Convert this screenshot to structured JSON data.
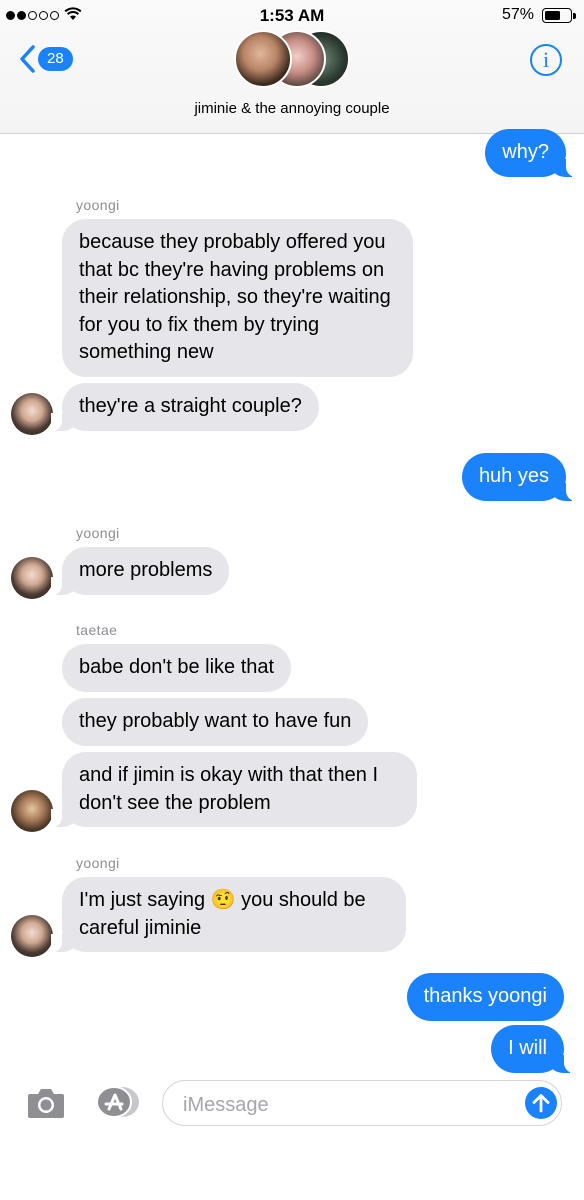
{
  "status_bar": {
    "time": "1:53 AM",
    "battery_percent": "57%",
    "battery_level": 0.57,
    "signal_bars_filled": 2,
    "signal_bars_total": 5
  },
  "header": {
    "back_count": "28",
    "title": "jiminie & the annoying couple",
    "info_glyph": "i"
  },
  "messages": [
    {
      "text": "why?"
    },
    {
      "sender": "yoongi",
      "text": "because they probably offered you that bc they're having problems on their relationship, so they're waiting for you to fix them by trying something new"
    },
    {
      "text": "they're a straight couple?"
    },
    {
      "text": "huh yes"
    },
    {
      "sender": "yoongi",
      "text": "more problems"
    },
    {
      "sender": "taetae",
      "text": "babe don't be like that"
    },
    {
      "text": "they probably want to have fun"
    },
    {
      "text": "and if jimin is okay with that then I don't see the problem"
    },
    {
      "sender": "yoongi",
      "text_before": "I'm just saying",
      "emoji": "🤨",
      "text_after": "you should be careful jiminie"
    },
    {
      "text": "thanks yoongi"
    },
    {
      "text": "I will"
    }
  ],
  "input": {
    "placeholder": "iMessage"
  },
  "icons": {
    "camera": "camera-icon",
    "apps": "app-store-icon",
    "send": "send-arrow-icon",
    "back": "chevron-left-icon",
    "wifi": "wifi-icon",
    "info": "info-icon"
  },
  "colors": {
    "accent": "#1a82fb",
    "incoming_bubble": "#e5e5ea",
    "sender_label": "#8e8e93"
  }
}
